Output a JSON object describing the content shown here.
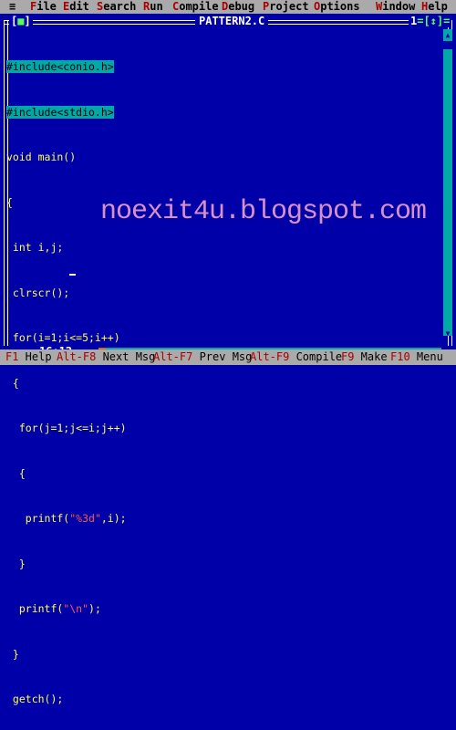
{
  "menu": {
    "system_icon": "≡",
    "items": [
      {
        "hot": "F",
        "rest": "ile"
      },
      {
        "hot": "E",
        "rest": "dit"
      },
      {
        "hot": "S",
        "rest": "earch"
      },
      {
        "hot": "R",
        "rest": "un"
      },
      {
        "hot": "C",
        "rest": "ompile"
      },
      {
        "hot": "D",
        "rest": "ebug"
      },
      {
        "hot": "P",
        "rest": "roject"
      },
      {
        "hot": "O",
        "rest": "ptions"
      },
      {
        "hot": "W",
        "rest": "indow"
      },
      {
        "hot": "H",
        "rest": "elp"
      }
    ]
  },
  "window": {
    "close_left": "[",
    "close_mark": "■",
    "close_right": "]",
    "title": "PATTERN2.C",
    "number": "1",
    "zoom": "=[↕]="
  },
  "code_lines": [
    [
      "#include<conio.h>"
    ],
    [
      "#include<stdio.h>"
    ],
    [
      "void main()"
    ],
    [
      "{"
    ],
    [
      " int i,j;"
    ],
    [
      " clrscr();"
    ],
    [
      " for(i=1;i<=5;i++)"
    ],
    [
      " {"
    ],
    [
      "  for(j=1;j<=i;j++)"
    ],
    [
      "  {"
    ],
    [
      "   printf(",
      "\"%3d\"",
      ",i);"
    ],
    [
      "  }"
    ],
    [
      "  printf(",
      "\"\\n\"",
      ");"
    ],
    [
      " }"
    ],
    [
      " getch();"
    ],
    [
      "}"
    ]
  ],
  "watermark": "noexit4u.blogspot.com",
  "cursor_position": "16:12",
  "status_hints": [
    {
      "key": "F1",
      "label": " Help"
    },
    {
      "key": "Alt-F8",
      "label": " Next Msg"
    },
    {
      "key": "Alt-F7",
      "label": " Prev Msg"
    },
    {
      "key": "Alt-F9",
      "label": " Compile"
    },
    {
      "key": "F9",
      "label": " Make"
    },
    {
      "key": "F10",
      "label": " Menu"
    }
  ],
  "colors": {
    "background": "#0000a8",
    "code_text": "#ffff55",
    "include_highlight": "#00a8a8",
    "string_literal": "#ff5555",
    "menu_bar": "#aaaaaa",
    "hotkey": "#a80000"
  }
}
